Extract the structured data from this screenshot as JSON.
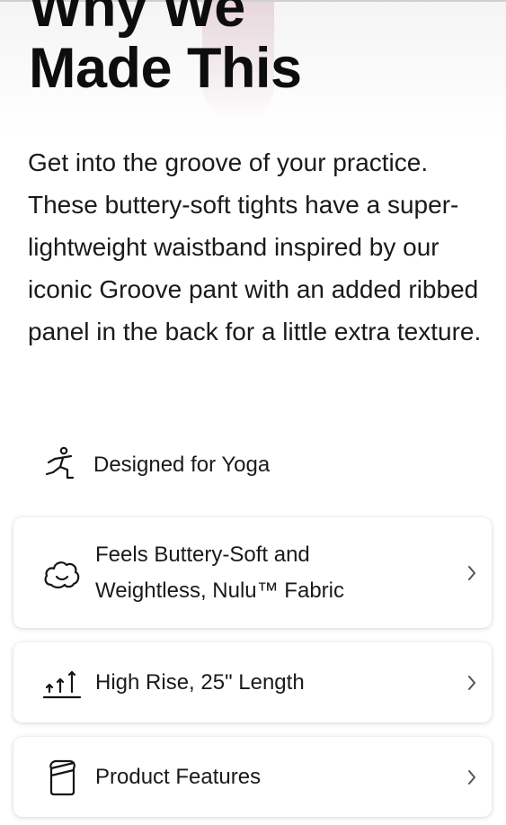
{
  "section": {
    "heading_line1": "Why We",
    "heading_line2": "Made This",
    "description": "Get into the groove of your practice. These buttery-soft tights have a super-lightweight waistband inspired by our iconic Groove pant with an added ribbed panel in the back for a little extra texture."
  },
  "activity": {
    "icon": "yoga-pose-icon",
    "label": "Designed for Yoga"
  },
  "cards": [
    {
      "icon": "cloud-icon",
      "line1": "Feels Buttery-Soft and",
      "line2": "Weightless, Nulu™ Fabric"
    },
    {
      "icon": "rise-arrows-icon",
      "label": "High Rise, 25\" Length"
    },
    {
      "icon": "tag-icon",
      "label": "Product Features"
    }
  ],
  "colors": {
    "text": "#141414",
    "card_bg": "#ffffff",
    "chevron": "#555555"
  }
}
